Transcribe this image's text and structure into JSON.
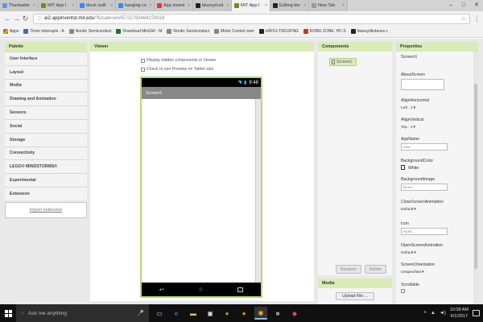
{
  "browser": {
    "tabs": [
      {
        "title": "Thunkable",
        "favicon_color": "#5b9bd5",
        "active": false
      },
      {
        "title": "MIT App I",
        "favicon_color": "#6b8e23",
        "active": false
      },
      {
        "title": "block outli",
        "favicon_color": "#4285f4",
        "active": false
      },
      {
        "title": "hanging co",
        "favicon_color": "#4285f4",
        "active": false
      },
      {
        "title": "App Invent",
        "favicon_color": "#e53935",
        "active": false
      },
      {
        "title": "bluesy/cod",
        "favicon_color": "#222222",
        "active": false
      },
      {
        "title": "MIT App I",
        "favicon_color": "#6b8e23",
        "active": true
      },
      {
        "title": "Editing blo",
        "favicon_color": "#222222",
        "active": false
      },
      {
        "title": "New Tab",
        "favicon_color": "#999999",
        "active": false
      }
    ],
    "window_controls": {
      "minimize": "–",
      "maximize": "□",
      "close": "✕"
    },
    "nav": {
      "back": "←",
      "forward": "→",
      "reload": "↻"
    },
    "address": {
      "host": "ai2.appinventor.mit.edu",
      "path": "/?locale=en#5722763464278016"
    },
    "bookmarks": [
      {
        "label": "Apps",
        "color": "#4285f4"
      },
      {
        "label": "Timer interrupts - A",
        "color": "#3b6fb6"
      },
      {
        "label": "Nordic Semiconduct",
        "color": "#888888"
      },
      {
        "label": "Download MinGW - M",
        "color": "#2c6e2c"
      },
      {
        "label": "Nordic Semiconduct",
        "color": "#888888"
      },
      {
        "label": "Motor Control over",
        "color": "#888888"
      },
      {
        "label": "nRF51-T6612FNG",
        "color": "#222222"
      },
      {
        "label": "ROBU ZONE: HC-S",
        "color": "#c0392b"
      },
      {
        "label": "bluesy/distance.c",
        "color": "#222222"
      }
    ]
  },
  "palette": {
    "header": "Palette",
    "items": [
      "User Interface",
      "Layout",
      "Media",
      "Drawing and Animation",
      "Sensors",
      "Social",
      "Storage",
      "Connectivity",
      "LEGO® MINDSTORMS®",
      "Experimental",
      "Extension"
    ],
    "import_link": "Import extension"
  },
  "viewer": {
    "header": "Viewer",
    "hidden_label": "Display hidden components in Viewer",
    "tablet_label": "Check to see Preview on Tablet size",
    "phone": {
      "time": "9:48",
      "screen_title": "Screen1"
    }
  },
  "components": {
    "header": "Components",
    "tree_item": "Screen1",
    "rename": "Rename",
    "delete": "Delete"
  },
  "media": {
    "header": "Media",
    "upload": "Upload File ..."
  },
  "properties": {
    "header": "Properties",
    "component": "Screen1",
    "fields": {
      "about_label": "AboutScreen",
      "align_h_label": "AlignHorizontal",
      "align_h_value": "Left : 1",
      "align_v_label": "AlignVertical",
      "align_v_value": "Top : 1",
      "appname_label": "AppName",
      "appname_value": "new",
      "bgcolor_label": "BackgroundColor",
      "bgcolor_value": "White",
      "bgimage_label": "BackgroundImage",
      "bgimage_value": "None...",
      "close_anim_label": "CloseScreenAnimation",
      "close_anim_value": "Default",
      "icon_label": "Icon",
      "icon_value": "None...",
      "open_anim_label": "OpenScreenAnimation",
      "open_anim_value": "Default",
      "orientation_label": "ScreenOrientation",
      "orientation_value": "Unspecified",
      "scrollable_label": "Scrollable"
    }
  },
  "taskbar": {
    "search_placeholder": "Ask me anything",
    "time": "10:08 AM",
    "date": "6/1/2017"
  }
}
